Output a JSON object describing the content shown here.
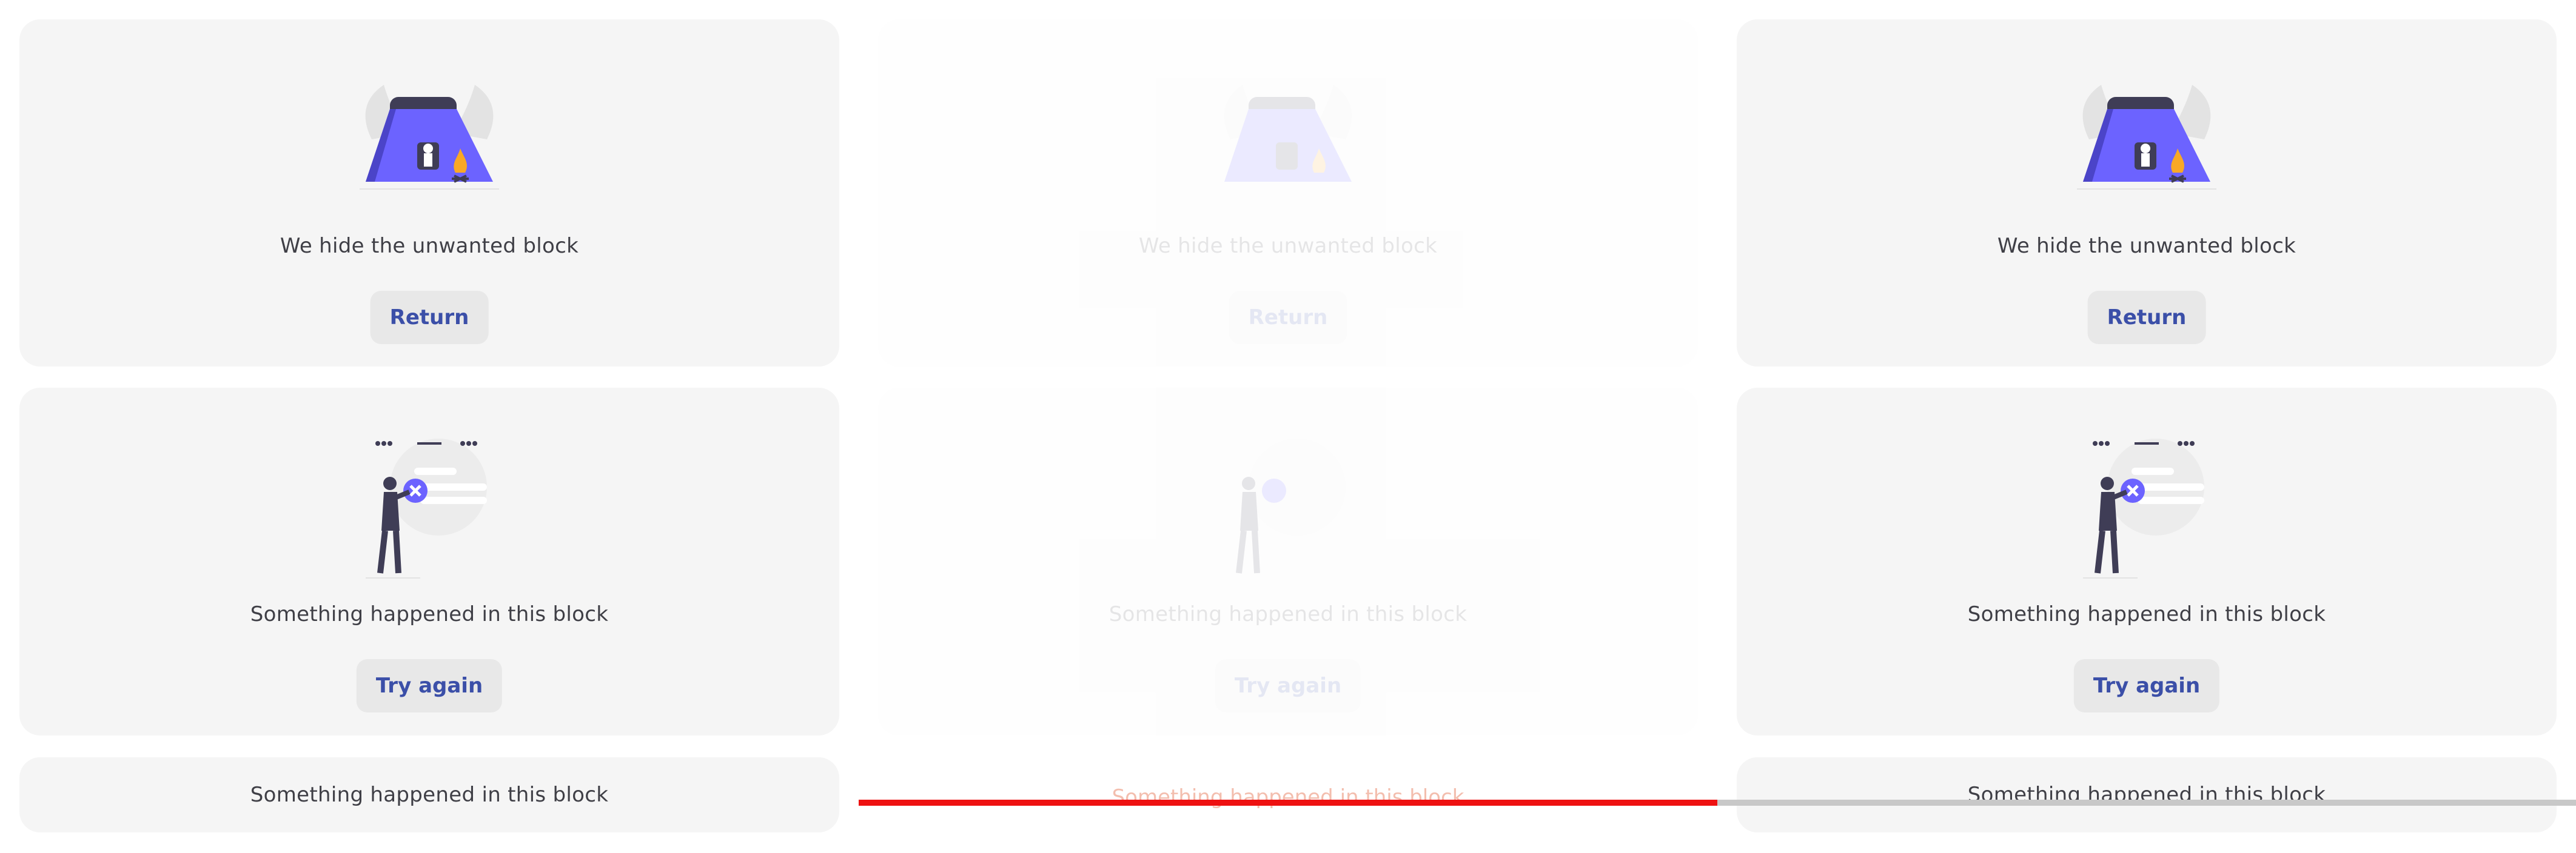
{
  "cards": [
    {
      "message": "We hide the unwanted block",
      "button": "Return"
    },
    {
      "message": "Something happened in this block",
      "button": "Try again"
    },
    {
      "message": "Something happened in this block"
    }
  ],
  "overlay_message": "Something happened in this block",
  "colors": {
    "card_bg": "#f5f5f5",
    "button_bg": "#e8e8e8",
    "button_text": "#3b4fa8",
    "accent": "#6c63ff",
    "progress_active": "#ee1111",
    "progress_inactive": "#c8c8c8"
  },
  "icons": [
    "tent-campfire-illustration",
    "person-error-illustration"
  ]
}
